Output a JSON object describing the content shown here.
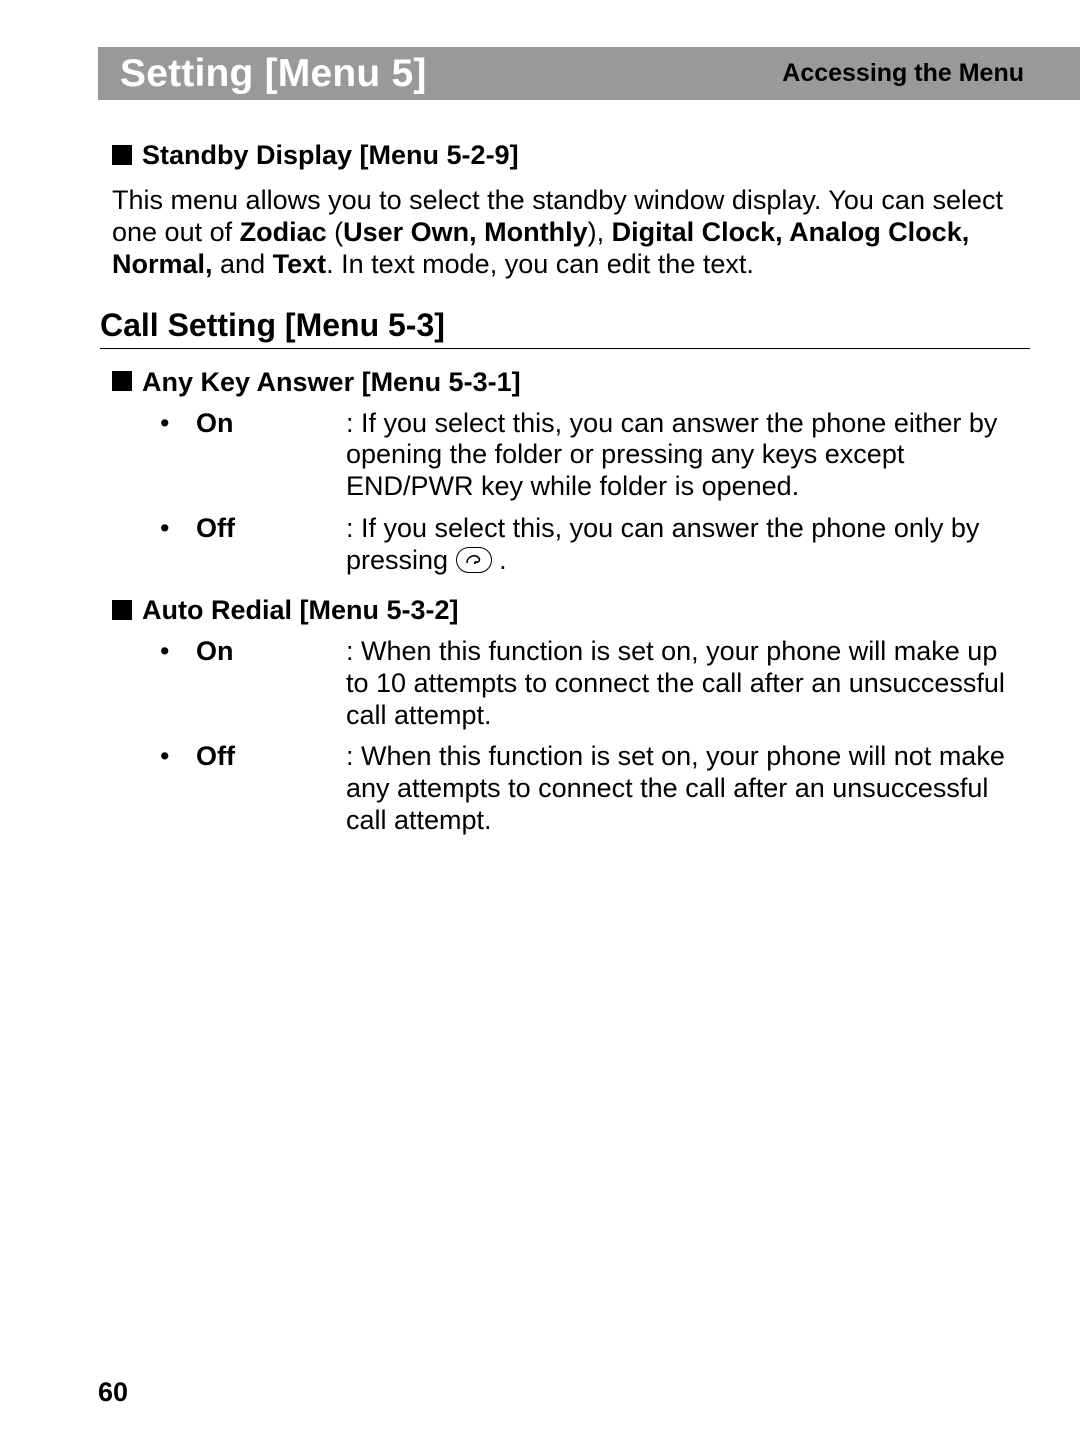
{
  "header": {
    "title": "Setting [Menu 5]",
    "subtitle": "Accessing the Menu"
  },
  "section1": {
    "heading": "Standby Display [Menu 5-2-9]",
    "para_lead": "This menu allows you to select the standby window display. You can select one out of ",
    "bold1": "Zodiac",
    "sep1": " (",
    "bold2": "User Own, Monthly",
    "sep2": "), ",
    "bold3": "Digital Clock, Analog Clock, Normal,",
    "sep3": " and ",
    "bold4": "Text",
    "para_tail": ". In text mode, you can edit the text."
  },
  "section2": {
    "heading": "Call Setting [Menu 5-3]",
    "sub1": {
      "heading": "Any Key Answer [Menu 5-3-1]",
      "on": {
        "label": "On",
        "desc": ": If you select this, you can answer the phone either by opening the folder or pressing any keys except END/PWR key while folder is opened."
      },
      "off": {
        "label": "Off",
        "desc_lead": ": If you select this, you can answer the phone only by pressing ",
        "desc_tail": " ."
      }
    },
    "sub2": {
      "heading": "Auto Redial [Menu 5-3-2]",
      "on": {
        "label": "On",
        "desc": ": When this function is set on, your phone will make up to 10 attempts to connect the call after an unsuccessful call attempt."
      },
      "off": {
        "label": "Off",
        "desc": ": When this function is set on, your phone will not make any attempts to connect the call after an unsuccessful call attempt."
      }
    }
  },
  "page_number": "60"
}
